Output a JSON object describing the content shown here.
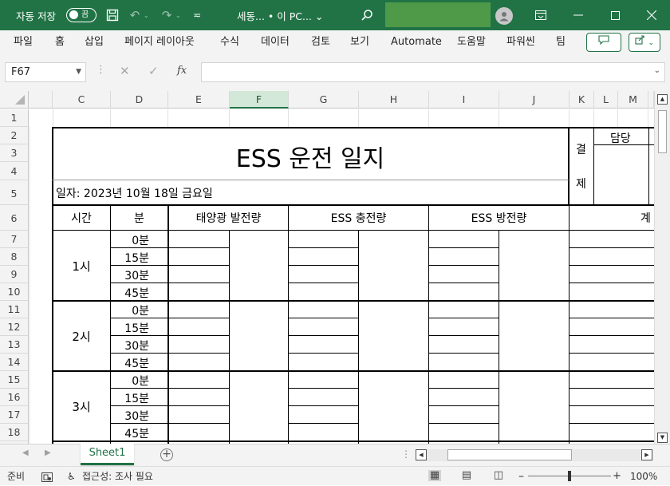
{
  "titlebar": {
    "autosave_label": "자동 저장",
    "autosave_state": "끔",
    "filename": "세동... • 이 PC... ⌄",
    "icons": [
      "save-icon",
      "undo-icon",
      "redo-icon",
      "customize-qat-icon",
      "search-icon",
      "user-avatar-icon",
      "ribbon-display-icon",
      "minimize-icon",
      "maximize-icon",
      "close-icon"
    ],
    "accent_color": "#217346"
  },
  "menu": {
    "items": [
      "파일",
      "홈",
      "삽입",
      "페이지 레이아웃",
      "수식",
      "데이터",
      "검토",
      "보기",
      "Automate",
      "도움말",
      "파워씬",
      "팀"
    ]
  },
  "formula_bar": {
    "name_box": "F67",
    "fx_label": "fx",
    "value": ""
  },
  "grid": {
    "columns": [
      "C",
      "D",
      "E",
      "F",
      "G",
      "H",
      "I",
      "J",
      "K",
      "L",
      "M"
    ],
    "selected_column": "F",
    "rows": [
      "1",
      "2",
      "3",
      "4",
      "5",
      "6",
      "7",
      "8",
      "9",
      "10",
      "11",
      "12",
      "13",
      "14",
      "15",
      "16",
      "17",
      "18"
    ]
  },
  "sheet": {
    "title": "ESS 운전 일지",
    "date": "일자: 2023년 10월 18일 금요일",
    "approval_label_1": "결",
    "approval_label_2": "제",
    "approval_header": "담당",
    "headers": {
      "time": "시간",
      "minute": "분",
      "solar": "태양광 발전량",
      "ess_charge": "ESS 충전량",
      "ess_discharge": "ESS 방전량",
      "total_partial": "계"
    },
    "hours": [
      "1시",
      "2시",
      "3시"
    ],
    "minutes": [
      "0분",
      "15분",
      "30분",
      "45분"
    ]
  },
  "tabs": {
    "sheets": [
      "Sheet1"
    ],
    "active": "Sheet1"
  },
  "statusbar": {
    "ready": "준비",
    "accessibility": "접근성: 조사 필요",
    "zoom": "100%"
  }
}
